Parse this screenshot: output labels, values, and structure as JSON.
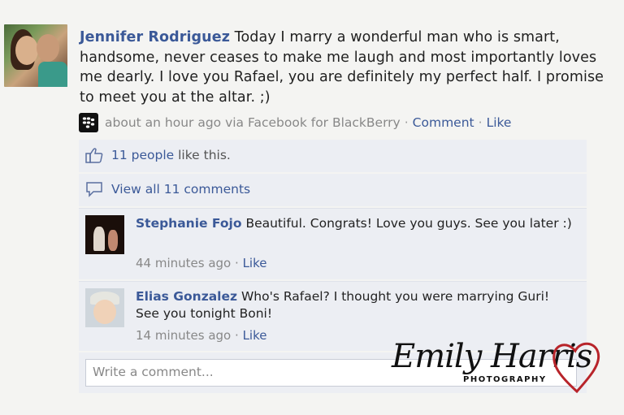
{
  "post": {
    "author": "Jennifer Rodriguez",
    "message": " Today I marry a wonderful man who is smart, handsome, never ceases to make me laugh and most importantly loves me dearly. I love you Rafael, you are definitely my perfect half. I promise to meet you at the altar. ;)",
    "timestamp": "about an hour ago via Facebook for BlackBerry",
    "comment_action": "Comment",
    "like_action": "Like",
    "separator": "·"
  },
  "feedback": {
    "likes_link": "11 people",
    "likes_suffix": " like this.",
    "view_comments": "View all 11 comments"
  },
  "comments": [
    {
      "name": "Stephanie Fojo",
      "text": " Beautiful. Congrats! Love you guys. See you later :)",
      "time": "44 minutes ago",
      "like": "Like"
    },
    {
      "name": "Elias Gonzalez",
      "text": " Who's Rafael? I thought you were marrying Guri! See you tonight Boni!",
      "time": "14 minutes ago",
      "like": "Like"
    }
  ],
  "composer": {
    "placeholder": "Write a comment..."
  },
  "watermark": {
    "name": "Emily Harris",
    "subtitle": "PHOTOGRAPHY"
  },
  "colors": {
    "link": "#3b5998",
    "panel": "#eceef3",
    "meta": "#888888"
  }
}
